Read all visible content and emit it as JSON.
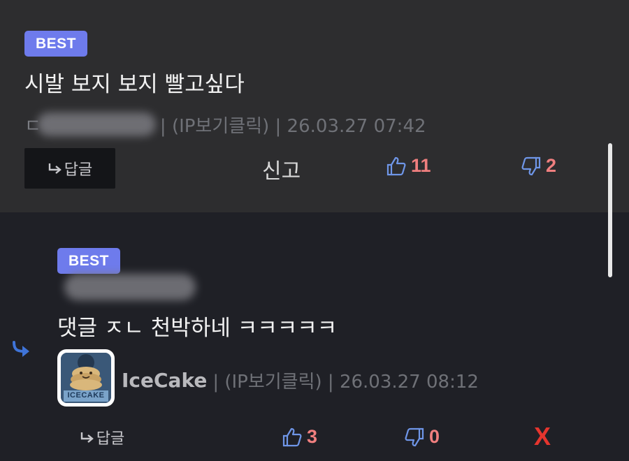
{
  "best_comment": {
    "badge": "BEST",
    "text": "시발 보지 보지 빨고싶다",
    "author_visible_prefix": "ㄷ",
    "meta_text": "| (IP보기클릭) | 26.03.27 07:42",
    "reply_label": "답글",
    "report_label": "신고",
    "likes": "11",
    "dislikes": "2"
  },
  "reply_comment": {
    "badge": "BEST",
    "text": "댓글 ㅈㄴ 천박하네 ㅋㅋㅋㅋㅋ",
    "author": "IceCake",
    "meta_text": "| (IP보기클릭) | 26.03.27 08:12",
    "avatar_caption": "ICECAKE",
    "reply_label": "답글",
    "likes": "3",
    "dislikes": "0",
    "delete_label": "X"
  },
  "colors": {
    "badge": "#6e7bec",
    "count": "#f07f7f",
    "icon_blue": "#6f96e8",
    "delete": "#e5352e"
  },
  "icons": [
    "reply-arrow-icon",
    "thumbs-up-icon",
    "thumbs-down-icon",
    "reply-indicator-icon"
  ]
}
